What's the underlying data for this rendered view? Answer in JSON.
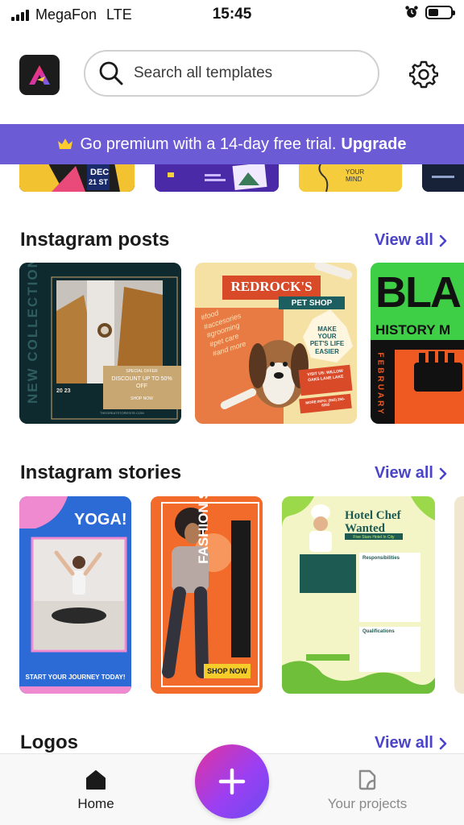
{
  "status_bar": {
    "carrier": "MegaFon",
    "network": "LTE",
    "time": "15:45"
  },
  "header": {
    "search_placeholder": "Search all templates"
  },
  "promo": {
    "text": "Go premium with a 14-day free trial.",
    "link": "Upgrade"
  },
  "peek_cards": {
    "card1_date": "DEC",
    "card1_day": "21 ST",
    "card3_text": "YOUR MIND"
  },
  "sections": {
    "posts": {
      "title": "Instagram posts",
      "view_all": "View all",
      "card1": {
        "vertical": "NEW COLLECTION",
        "offer_small": "SPECIAL OFFER",
        "offer": "DISCOUNT UP TO 50% OFF",
        "shop": "SHOP NOW",
        "year": "20 23",
        "site": "THEGREATSTORESITE.COM"
      },
      "card2": {
        "title": "REDROCK'S",
        "subtitle": "PET SHOP",
        "list": [
          "#food",
          "#accesories",
          "#grooming",
          "#pet care",
          "#and more"
        ],
        "badge": "MAKE YOUR PET'S LIFE EASIER",
        "visit": "VISIT US: WILLOW OAKS LANE LAKE",
        "phone": "MORE INFO: (555) 250-8255"
      },
      "card3": {
        "big": "BLA",
        "sub": "HISTORY M",
        "month": "FEBRUARY"
      }
    },
    "stories": {
      "title": "Instagram stories",
      "view_all": "View all",
      "card1": {
        "title": "YOGA!",
        "footer": "START YOUR JOURNEY TODAY!"
      },
      "card2": {
        "vertical": "FASHION SALE",
        "button": "SHOP NOW"
      },
      "card3": {
        "title": "Hotel Chef",
        "title2": "Wanted",
        "subtitle": "Five Stars Hotel In City",
        "resp": "Responsibilities",
        "qual": "Qualifications"
      }
    },
    "logos": {
      "title": "Logos",
      "view_all": "View all"
    }
  },
  "bottom_nav": {
    "home": "Home",
    "projects": "Your projects"
  },
  "colors": {
    "accent": "#4a44c9",
    "promo": "#6b5cd6",
    "fab_start": "#e3329d",
    "fab_end": "#6b4bf0"
  }
}
